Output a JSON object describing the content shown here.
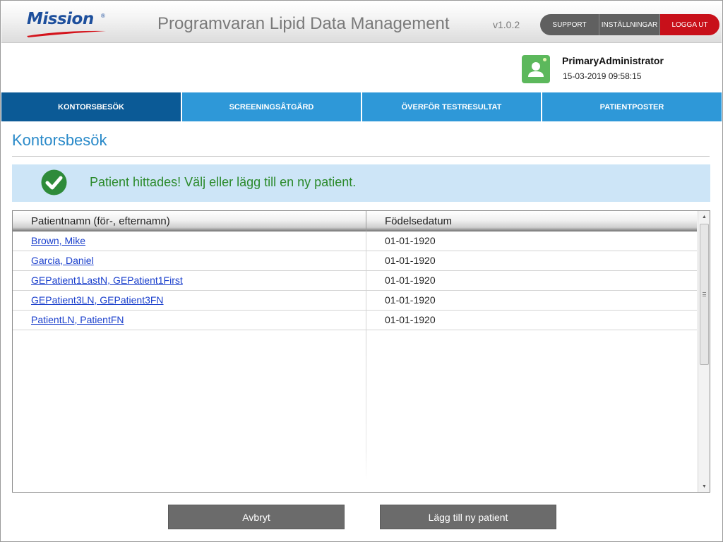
{
  "header": {
    "logo_text": "Mission",
    "logo_mark": "®",
    "app_title": "Programvaran Lipid Data Management",
    "version": "v1.0.2",
    "buttons": {
      "support": "SUPPORT",
      "settings": "INSTÄLLNINGAR",
      "logout": "LOGGA UT"
    }
  },
  "user": {
    "name": "PrimaryAdministrator",
    "datetime": "15-03-2019 09:58:15",
    "avatar_icon": "user-icon"
  },
  "nav": {
    "tabs": [
      {
        "label": "KONTORSBESÖK",
        "active": true
      },
      {
        "label": "SCREENINGSÅTGÄRD",
        "active": false
      },
      {
        "label": "ÖVERFÖR TESTRESULTAT",
        "active": false
      },
      {
        "label": "PATIENTPOSTER",
        "active": false
      }
    ]
  },
  "page": {
    "title": "Kontorsbesök"
  },
  "banner": {
    "icon": "check-circle-icon",
    "message": "Patient hittades! Välj eller lägg till en ny patient."
  },
  "table": {
    "headers": [
      "Patientnamn (för-, efternamn)",
      "Födelsedatum"
    ],
    "rows": [
      {
        "name": "Brown, Mike",
        "dob": "01-01-1920"
      },
      {
        "name": "Garcia, Daniel",
        "dob": "01-01-1920"
      },
      {
        "name": "GEPatient1LastN, GEPatient1First",
        "dob": "01-01-1920"
      },
      {
        "name": "GEPatient3LN, GEPatient3FN",
        "dob": "01-01-1920"
      },
      {
        "name": "PatientLN, PatientFN",
        "dob": "01-01-1920"
      }
    ]
  },
  "buttons": {
    "cancel": "Avbryt",
    "add_patient": "Lägg till ny patient"
  },
  "colors": {
    "brand": "#1d4f9c",
    "nav_active": "#0b5a96",
    "nav_inactive": "#2e98d8",
    "logout": "#c8101a",
    "success": "#2b8a2b",
    "banner_bg": "#cde5f7"
  }
}
